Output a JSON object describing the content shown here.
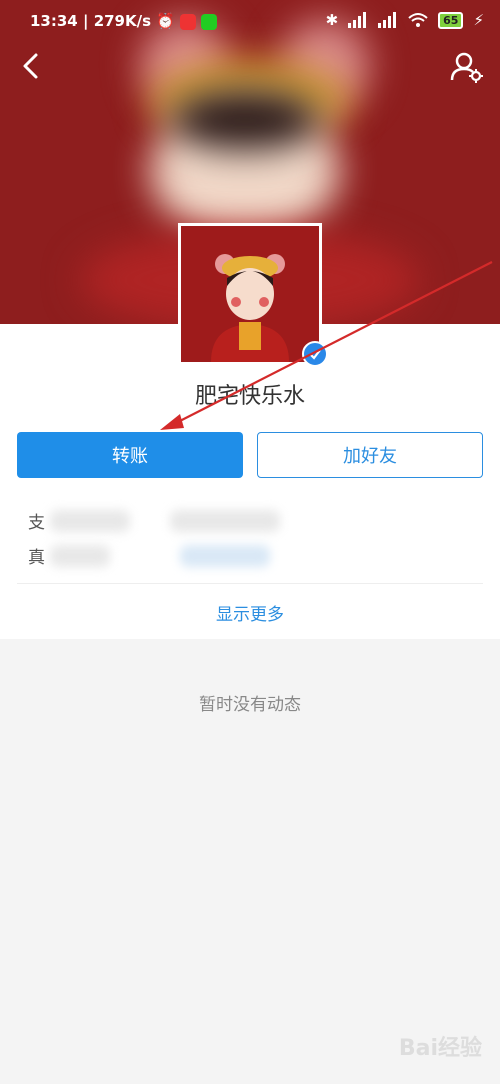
{
  "status_bar": {
    "time": "13:34",
    "speed": "279K/s",
    "battery": "65"
  },
  "profile": {
    "name": "肥宅快乐水",
    "transfer_label": "转账",
    "add_friend_label": "加好友",
    "info_rows": [
      {
        "label": "支"
      },
      {
        "label": "真"
      }
    ],
    "show_more_label": "显示更多"
  },
  "feed": {
    "empty_text": "暂时没有动态"
  },
  "icons": {
    "back": "back-arrow-icon",
    "settings": "user-settings-icon",
    "verified": "verified-badge-icon"
  },
  "colors": {
    "header_red": "#8e1e1e",
    "primary_blue": "#1f8ee8",
    "annotation_red": "#d42a2a"
  },
  "watermark": "Bai经验"
}
